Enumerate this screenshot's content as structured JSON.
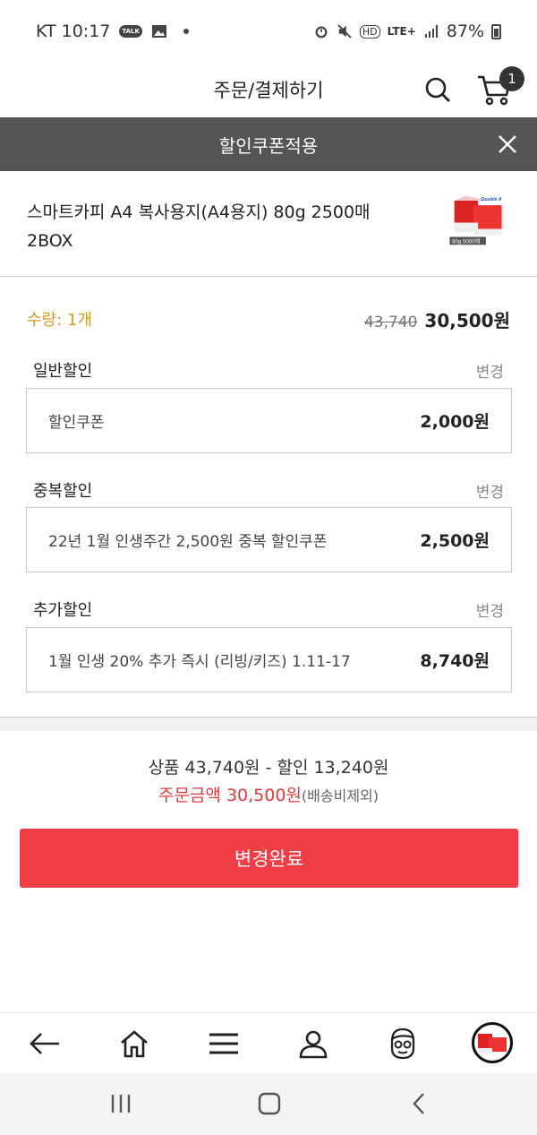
{
  "status": {
    "carrier_time": "KT 10:17",
    "talk_badge": "TALK",
    "network": "LTE+",
    "hd": "HD",
    "battery": "87%"
  },
  "header": {
    "title": "주문/결제하기",
    "cart_count": "1"
  },
  "coupon_bar": {
    "title": "할인쿠폰적용"
  },
  "product": {
    "name": "스마트카피 A4 복사용지(A4용지) 80g 2500매 2BOX",
    "thumb_brand": "Double A",
    "thumb_caption": "80g 5000매"
  },
  "order": {
    "qty_label": "수량: 1개",
    "old_price": "43,740",
    "new_price": "30,500원"
  },
  "sections": [
    {
      "title": "일반할인",
      "change": "변경",
      "label": "할인쿠폰",
      "amount": "2,000원"
    },
    {
      "title": "중복할인",
      "change": "변경",
      "label": "22년 1월 인생주간 2,500원 중복 할인쿠폰",
      "amount": "2,500원"
    },
    {
      "title": "추가할인",
      "change": "변경",
      "label": "1월 인생 20% 추가 즉시 (리빙/키즈) 1.11-17",
      "amount": "8,740원"
    }
  ],
  "summary": {
    "line1": "상품 43,740원 - 할인 13,240원",
    "total_label": "주문금액",
    "total_value": "30,500원",
    "total_note": "(배송비제외)"
  },
  "cta": {
    "label": "변경완료"
  },
  "bottom_nav": [
    "back-icon",
    "home-icon",
    "menu-icon",
    "user-icon",
    "face-icon",
    "recent-product-thumb"
  ],
  "colors": {
    "accent": "#ef3e45",
    "qty": "#d49c2a",
    "bar": "#555555"
  }
}
